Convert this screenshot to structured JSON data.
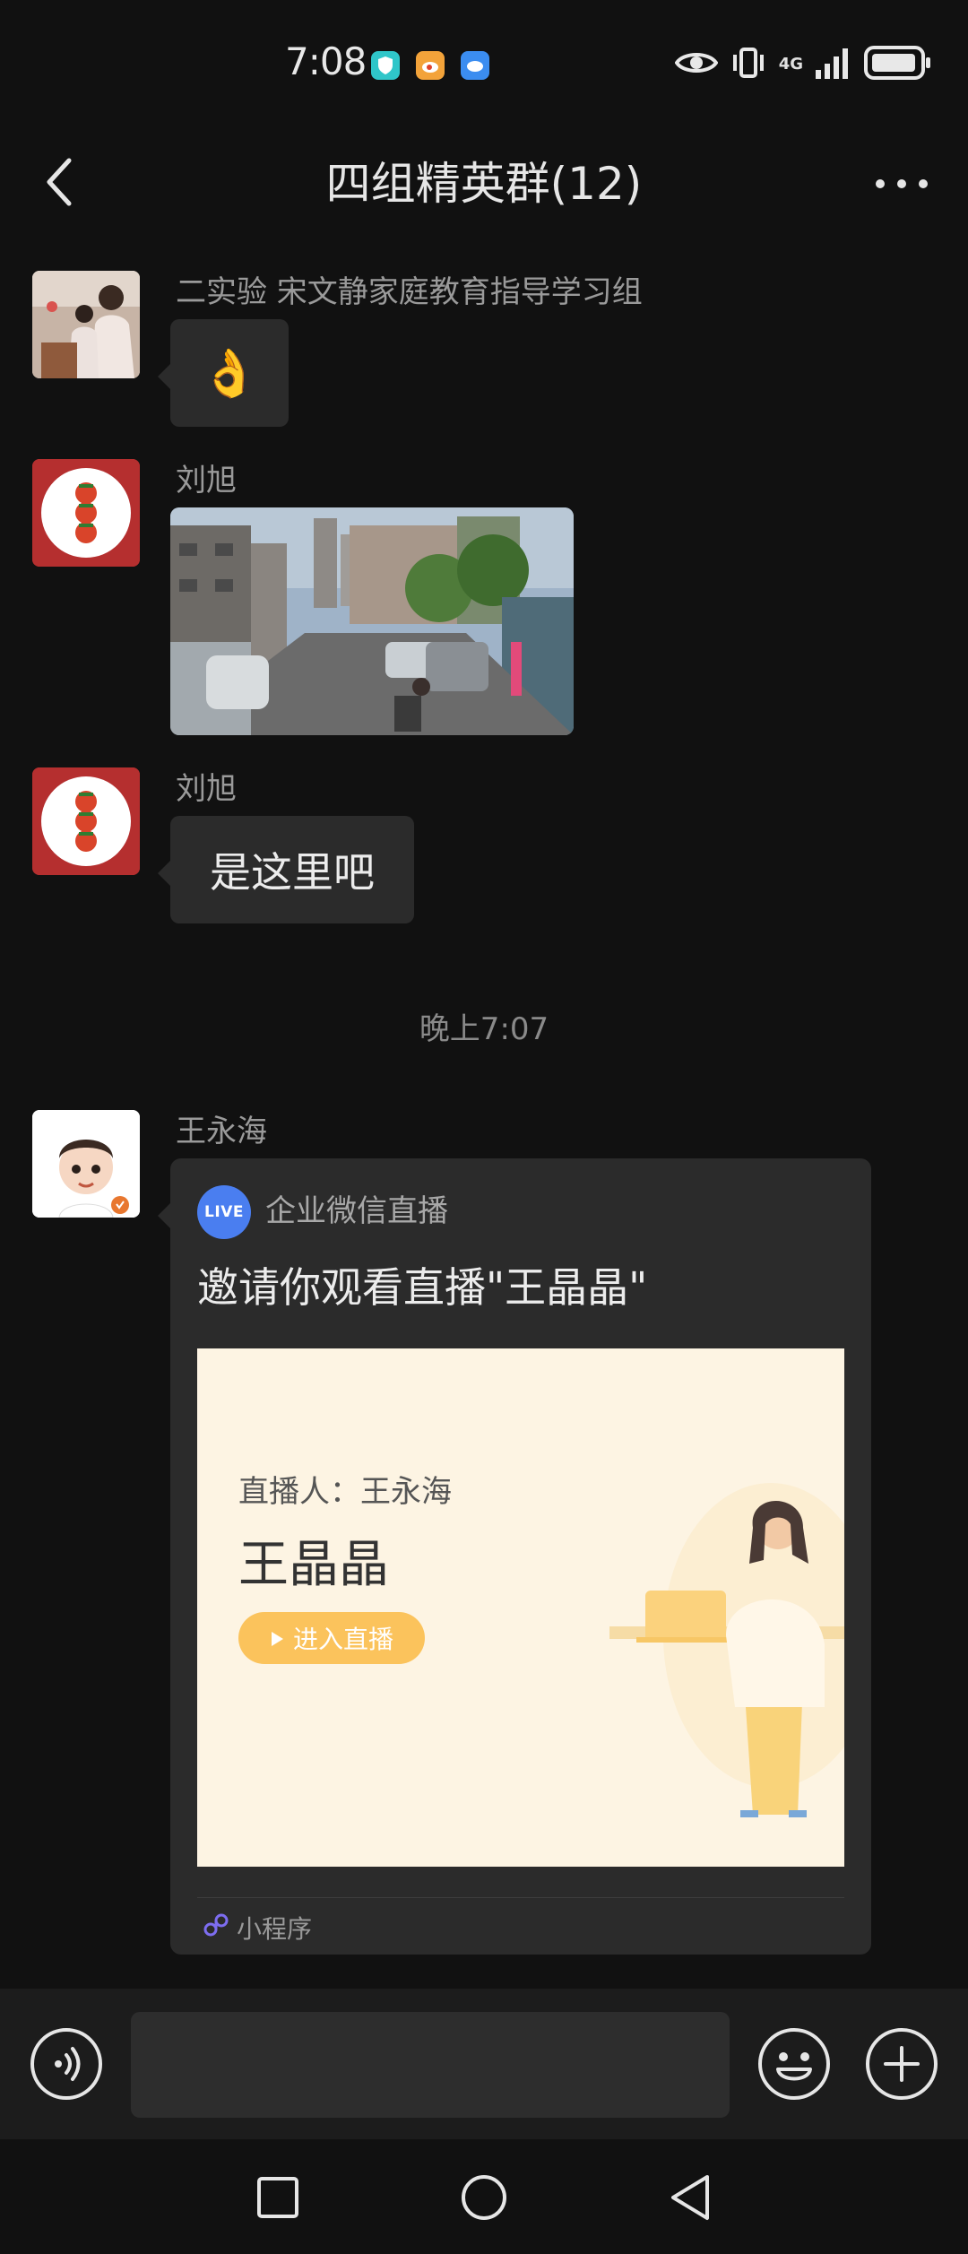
{
  "status_bar": {
    "time": "7:08",
    "network": "4G",
    "icons": [
      "shield-app-icon",
      "weibo-icon",
      "cloud-app-icon",
      "eye-icon",
      "vibrate-icon",
      "signal-icon",
      "battery-icon"
    ]
  },
  "header": {
    "title": "四组精英群(12)",
    "back_icon": "chevron-left-icon",
    "more_icon": "more-dots-icon"
  },
  "messages": [
    {
      "sender": "二实验 宋文静家庭教育指导学习组",
      "type": "emoji",
      "content": "👌"
    },
    {
      "sender": "刘旭",
      "type": "image",
      "content": "street photo"
    },
    {
      "sender": "刘旭",
      "type": "text",
      "content": "是这里吧"
    }
  ],
  "timestamp": "晚上7:07",
  "live_message": {
    "sender": "王永海",
    "badge": "LIVE",
    "source": "企业微信直播",
    "title": "邀请你观看直播\"王晶晶\"",
    "host_label": "直播人：王永海",
    "stream_name": "王晶晶",
    "enter_label": "进入直播",
    "footer": "小程序"
  },
  "input_bar": {
    "voice_icon": "voice-icon",
    "emoji_icon": "emoji-icon",
    "plus_icon": "plus-icon",
    "placeholder": ""
  },
  "nav_bar": {
    "icons": [
      "recent-apps-icon",
      "home-icon",
      "back-icon"
    ]
  },
  "colors": {
    "background": "#111111",
    "bubble": "#2b2b2b",
    "live_blue": "#4a7ef0",
    "accent_yellow": "#fbc35c"
  }
}
